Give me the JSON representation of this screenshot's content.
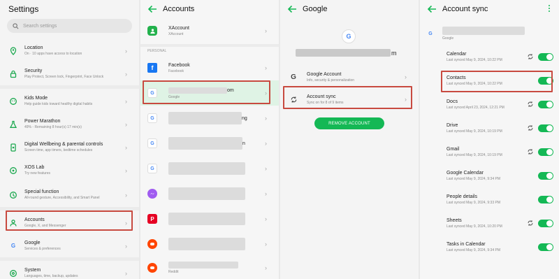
{
  "settings": {
    "title": "Settings",
    "search_placeholder": "Search settings",
    "items": [
      {
        "label": "Location",
        "sub": "On · 10 apps have access to location"
      },
      {
        "label": "Security",
        "sub": "Play Protect, Screen lock, Fingerprint, Face Unlock"
      },
      {
        "label": "Kids Mode",
        "sub": "Help guide kids toward healthy digital habits"
      },
      {
        "label": "Power Marathon",
        "sub": "49% - Remaining 8 hour(s) 17 min(s)"
      },
      {
        "label": "Digital Wellbeing & parental controls",
        "sub": "Screen time, app timers, bedtime schedules"
      },
      {
        "label": "XOS Lab",
        "sub": "Try new features"
      },
      {
        "label": "Special function",
        "sub": "All-round gesture, Accessibility, and Smart Panel"
      },
      {
        "label": "Accounts",
        "sub": "Google, X, and Messenger"
      },
      {
        "label": "Google",
        "sub": "Services & preferences"
      },
      {
        "label": "System",
        "sub": "Languages, time, backup, updates"
      }
    ]
  },
  "accounts": {
    "title": "Accounts",
    "xaccount": {
      "label": "XAccount",
      "sub": "XAccount"
    },
    "section": "PERSONAL",
    "facebook": {
      "label": "Facebook",
      "sub": "Facebook"
    },
    "google_selected": {
      "label_tail": "om",
      "sub": "Google"
    },
    "partial_labels": [
      "ng",
      "n"
    ],
    "reddit_sub": "Reddit"
  },
  "google": {
    "title": "Google",
    "email_tail": "m",
    "items": [
      {
        "label": "Google Account",
        "sub": "Info, security & personalization"
      },
      {
        "label": "Account sync",
        "sub": "Sync on for 8 of 9 items"
      }
    ],
    "remove_button": "REMOVE ACCOUNT"
  },
  "sync": {
    "title": "Account sync",
    "account_sub": "Google",
    "items": [
      {
        "label": "Calendar",
        "sub": "Last synced May 9, 2024, 10:22 PM"
      },
      {
        "label": "Contacts",
        "sub": "Last synced May 9, 2024, 10:22 PM"
      },
      {
        "label": "Docs",
        "sub": "Last synced April 23, 2024, 12:21 PM"
      },
      {
        "label": "Drive",
        "sub": "Last synced May 9, 2024, 10:19 PM"
      },
      {
        "label": "Gmail",
        "sub": "Last synced May 9, 2024, 10:19 PM"
      },
      {
        "label": "Google Calendar",
        "sub": "Last synced May 9, 2024, 9:34 PM"
      },
      {
        "label": "People details",
        "sub": "Last synced May 9, 2024, 9:33 PM"
      },
      {
        "label": "Sheets",
        "sub": "Last synced May 9, 2024, 10:20 PM"
      },
      {
        "label": "Tasks in Calendar",
        "sub": "Last synced May 9, 2024, 9:34 PM"
      }
    ]
  },
  "colors": {
    "accent": "#14b855",
    "highlight": "#c84a40"
  }
}
